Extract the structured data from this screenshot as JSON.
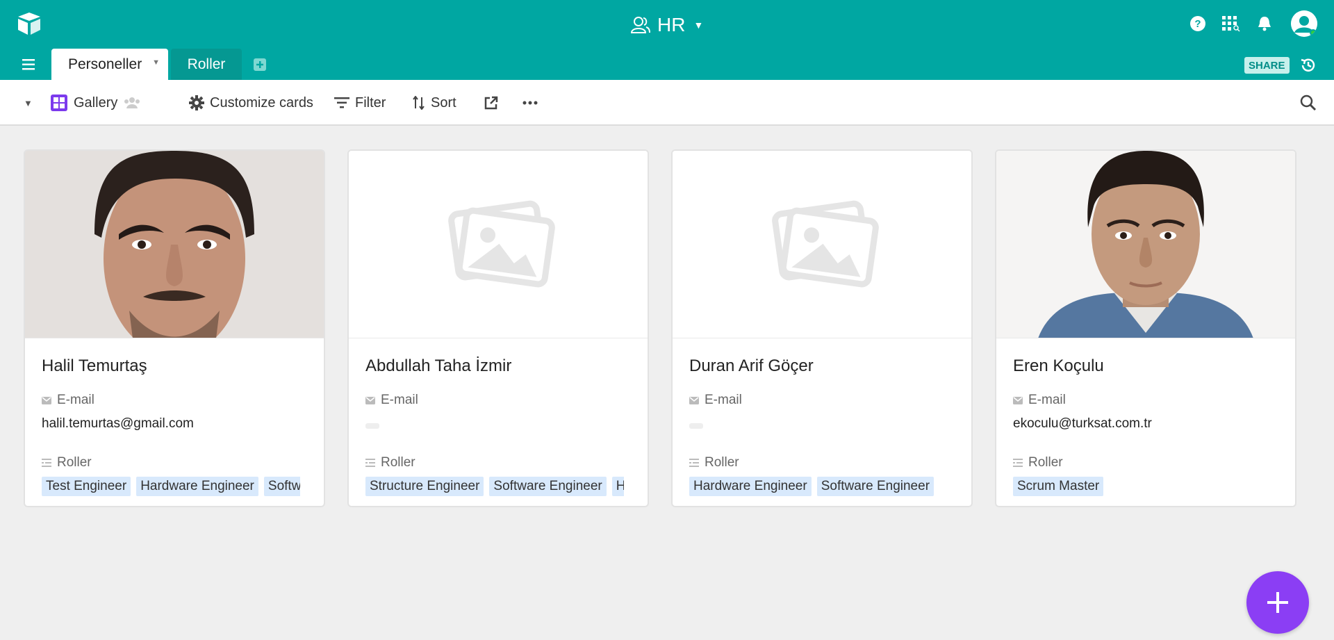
{
  "header": {
    "base_name": "HR",
    "icons": [
      "logo-icon",
      "base-users-icon",
      "help-icon",
      "apps-icon",
      "notifications-icon",
      "avatar"
    ]
  },
  "tabs": [
    {
      "label": "Personeller",
      "active": true
    },
    {
      "label": "Roller",
      "active": false
    }
  ],
  "share_label": "SHARE",
  "toolbar": {
    "view_name": "Gallery",
    "customize_label": "Customize cards",
    "filter_label": "Filter",
    "sort_label": "Sort"
  },
  "cards": [
    {
      "name": "Halil Temurtaş",
      "email_label": "E-mail",
      "email": "halil.temurtas@gmail.com",
      "roles_label": "Roller",
      "roles": [
        "Test Engineer",
        "Hardware Engineer",
        "Softw"
      ],
      "has_photo": true
    },
    {
      "name": "Abdullah Taha İzmir",
      "email_label": "E-mail",
      "email": "",
      "roles_label": "Roller",
      "roles": [
        "Structure Engineer",
        "Software Engineer",
        "H"
      ],
      "has_photo": false
    },
    {
      "name": "Duran Arif Göçer",
      "email_label": "E-mail",
      "email": "",
      "roles_label": "Roller",
      "roles": [
        "Hardware Engineer",
        "Software Engineer"
      ],
      "has_photo": false
    },
    {
      "name": "Eren Koçulu",
      "email_label": "E-mail",
      "email": "ekoculu@turksat.com.tr",
      "roles_label": "Roller",
      "roles": [
        "Scrum Master"
      ],
      "has_photo": true
    }
  ],
  "colors": {
    "header": "#00a7a2",
    "tab_inactive": "#059892",
    "tag_bg": "#d8e9fc",
    "fab": "#8b3ef4",
    "gallery_icon": "#7c3aed"
  }
}
